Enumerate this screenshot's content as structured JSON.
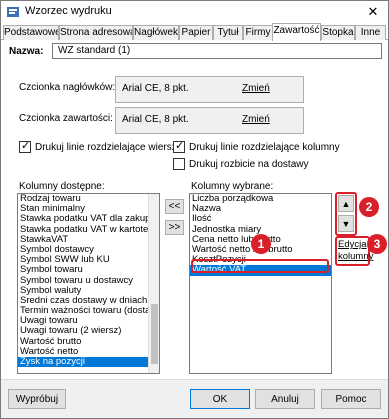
{
  "window": {
    "title": "Wzorzec wydruku",
    "close_glyph": "✕"
  },
  "tabs": [
    {
      "label": "Podstawowe",
      "active": false
    },
    {
      "label": "Strona adresowa",
      "active": false
    },
    {
      "label": "Nagłówek",
      "active": false
    },
    {
      "label": "Papier",
      "active": false
    },
    {
      "label": "Tytuł",
      "active": false
    },
    {
      "label": "Firmy",
      "active": false
    },
    {
      "label": "Zawartość",
      "active": true
    },
    {
      "label": "Stopka",
      "active": false
    },
    {
      "label": "Inne",
      "active": false
    }
  ],
  "name": {
    "label": "Nazwa:",
    "value": "WZ standard (1)"
  },
  "fonts": {
    "header_label": "Czcionka nagłówków:",
    "header_value": "Arial CE, 8 pkt.",
    "content_label": "Czcionka zawartości:",
    "content_value": "Arial CE, 8 pkt.",
    "change_label": "Zmień"
  },
  "checkboxes": {
    "row_lines": {
      "label": "Drukuj linie rozdzielające wiersze",
      "checked": true
    },
    "col_lines": {
      "label": "Drukuj linie rozdzielające kolumny",
      "checked": true
    },
    "delivery_split": {
      "label": "Drukuj rozbicie na dostawy",
      "checked": false
    }
  },
  "available": {
    "label": "Kolumny dostępne:",
    "items": [
      "Rodzaj towaru",
      "Stan minimalny",
      "Stawka podatku VAT dla zakupu w",
      "Stawka podatku VAT w kartotece t",
      "StawkaVAT",
      "Symbol dostawcy",
      "Symbol SWW lub KU",
      "Symbol towaru",
      "Symbol towaru u dostawcy",
      "Symbol waluty",
      "Średni czas dostawy w dniach",
      "Termin ważności towaru (dostawy)",
      "Uwagi towaru",
      "Uwagi towaru (2 wiersz)",
      "Wartość brutto",
      "Wartość netto",
      "Zysk na pozycji"
    ],
    "selected_index": 16
  },
  "move_buttons": {
    "remove": "<<",
    "add": ">>"
  },
  "chosen": {
    "label": "Kolumny wybrane:",
    "items": [
      "Liczba porządkowa",
      "Nazwa",
      "Ilość",
      "Jednostka miary",
      "Cena netto lub brutto",
      "Wartość netto lub brutto",
      "KosztPozycji",
      "Wartość VAT"
    ],
    "selected_index": 7
  },
  "order_buttons": {
    "up": "▲",
    "down": "▼"
  },
  "edit_column": {
    "line1": "Edycja",
    "line2": "kolumny"
  },
  "callouts": {
    "one": "1",
    "two": "2",
    "three": "3"
  },
  "footer": {
    "example": "Wypróbuj",
    "ok": "OK",
    "cancel": "Anuluj",
    "help": "Pomoc"
  },
  "colors": {
    "selection": "#0078d7",
    "callout": "#d81f2a"
  }
}
